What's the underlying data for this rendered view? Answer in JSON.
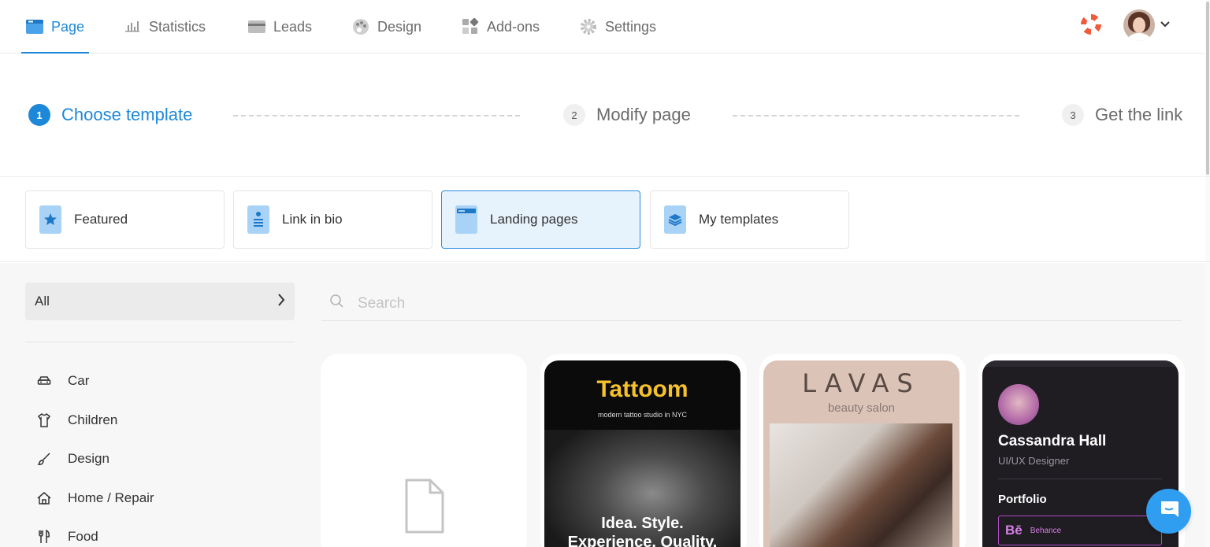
{
  "nav": {
    "items": [
      {
        "label": "Page",
        "icon": "page-icon",
        "active": true
      },
      {
        "label": "Statistics",
        "icon": "bar-chart-icon"
      },
      {
        "label": "Leads",
        "icon": "card-icon"
      },
      {
        "label": "Design",
        "icon": "palette-icon"
      },
      {
        "label": "Add-ons",
        "icon": "widgets-icon"
      },
      {
        "label": "Settings",
        "icon": "gear-icon"
      }
    ]
  },
  "steps": [
    {
      "number": "1",
      "label": "Choose template",
      "active": true
    },
    {
      "number": "2",
      "label": "Modify page"
    },
    {
      "number": "3",
      "label": "Get the link"
    }
  ],
  "categories": [
    {
      "label": "Featured",
      "icon": "star-doc-icon"
    },
    {
      "label": "Link in bio",
      "icon": "list-doc-icon"
    },
    {
      "label": "Landing pages",
      "icon": "window-doc-icon",
      "active": true
    },
    {
      "label": "My templates",
      "icon": "layers-doc-icon"
    }
  ],
  "filter": {
    "selected": "All",
    "items": [
      "Car",
      "Children",
      "Design",
      "Home / Repair",
      "Food"
    ]
  },
  "search": {
    "placeholder": "Search"
  },
  "templates": {
    "tattoo": {
      "title": "Tattoom",
      "subtitle": "modern tattoo studio in NYC",
      "tagline1": "Idea. Style.",
      "tagline2": "Experience. Quality."
    },
    "lavas": {
      "title": "LAVAS",
      "subtitle": "beauty salon"
    },
    "cassandra": {
      "name": "Cassandra Hall",
      "role": "UI/UX Designer",
      "section": "Portfolio",
      "link_logo": "Bē",
      "link_label": "Behance"
    }
  },
  "colors": {
    "accent": "#1e88d8",
    "active_bg": "#e6f2fc",
    "tattoo_yellow": "#f6c22c",
    "behance_purple": "#d77fe6"
  }
}
